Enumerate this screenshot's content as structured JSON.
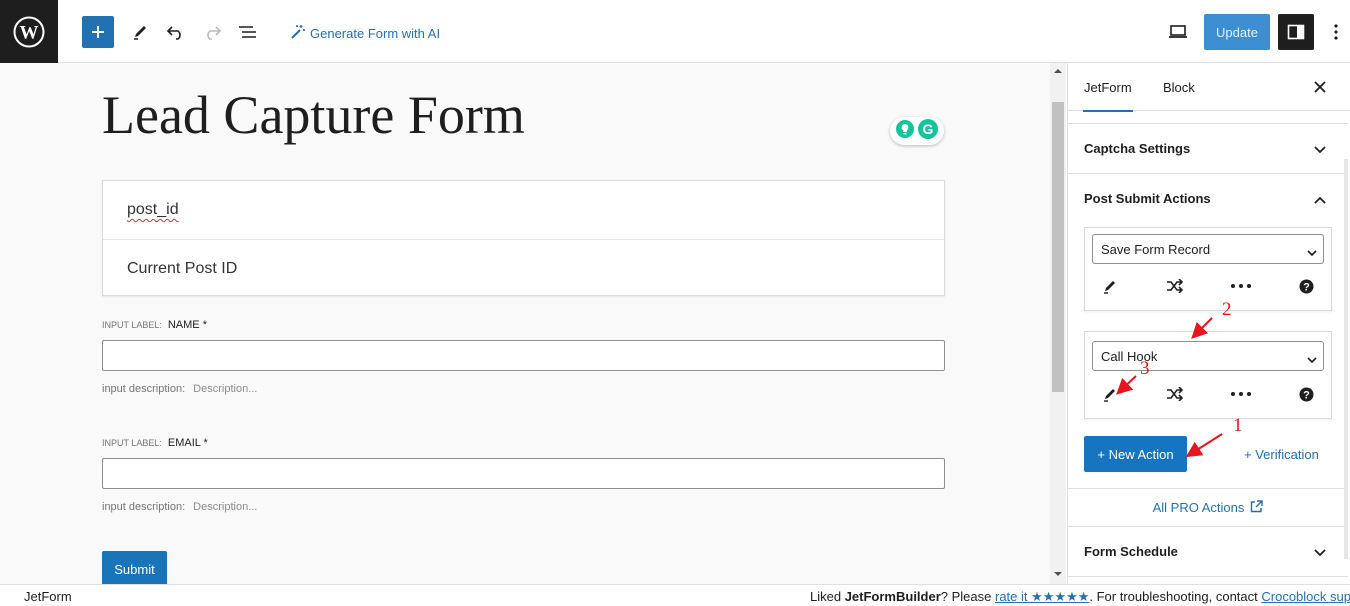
{
  "toolbar": {
    "generate_ai_label": "Generate Form with AI",
    "update_label": "Update"
  },
  "editor": {
    "page_title": "Lead Capture Form",
    "hidden_field": {
      "name": "post_id",
      "value": "Current Post ID"
    },
    "fields": [
      {
        "label_caption": "INPUT LABEL:",
        "label": "NAME *",
        "description_caption": "input description:",
        "description_placeholder": "Description..."
      },
      {
        "label_caption": "INPUT LABEL:",
        "label": "EMAIL *",
        "description_caption": "input description:",
        "description_placeholder": "Description..."
      }
    ],
    "submit_label": "Submit"
  },
  "sidebar": {
    "tabs": [
      "JetForm",
      "Block"
    ],
    "active_tab": "JetForm",
    "panels": {
      "captcha": "Captcha Settings",
      "post_submit": "Post Submit Actions",
      "form_schedule": "Form Schedule"
    },
    "actions": [
      {
        "selected": "Save Form Record"
      },
      {
        "selected": "Call Hook"
      }
    ],
    "new_action_label": "+ New Action",
    "verification_label": "+ Verification",
    "pro_actions_label": "All PRO Actions"
  },
  "statusbar": {
    "left": "JetForm",
    "liked": "Liked ",
    "product": "JetFormBuilder",
    "please": "? Please ",
    "rate_link": "rate it ★★★★★",
    "troubleshooting": ". For troubleshooting, contact ",
    "support_link": "Crocoblock suppo"
  },
  "annotations": [
    "1",
    "2",
    "3"
  ],
  "colors": {
    "accent": "#2271b1",
    "annotation": "#e8151b",
    "dark": "#1e1e1e"
  }
}
